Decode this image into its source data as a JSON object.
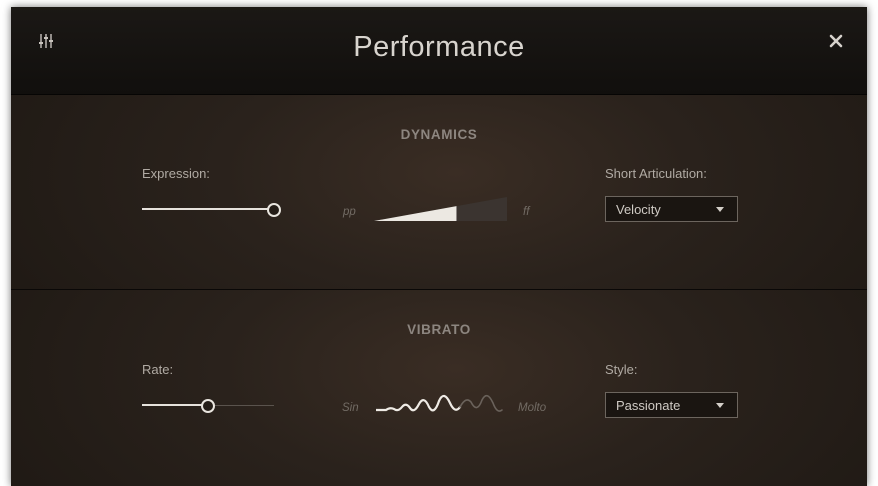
{
  "window": {
    "title": "Performance"
  },
  "header": {
    "left_icon": "mixer-sliders-icon",
    "right_icon": "close-icon"
  },
  "dynamics": {
    "section_title": "DYNAMICS",
    "expression": {
      "label": "Expression:",
      "value": 1.0
    },
    "meter": {
      "min_label": "pp",
      "max_label": "ff",
      "level": 0.62
    },
    "short_articulation": {
      "label": "Short Articulation:",
      "selected": "Velocity"
    }
  },
  "vibrato": {
    "section_title": "VIBRATO",
    "rate": {
      "label": "Rate:",
      "value": 0.5
    },
    "amount": {
      "min_label": "Sin",
      "max_label": "Molto"
    },
    "style": {
      "label": "Style:",
      "selected": "Passionate"
    }
  },
  "colors": {
    "background": "#1f1914",
    "header": "#15120f",
    "text": "#b0aaa3",
    "accent": "#e9e5df"
  }
}
